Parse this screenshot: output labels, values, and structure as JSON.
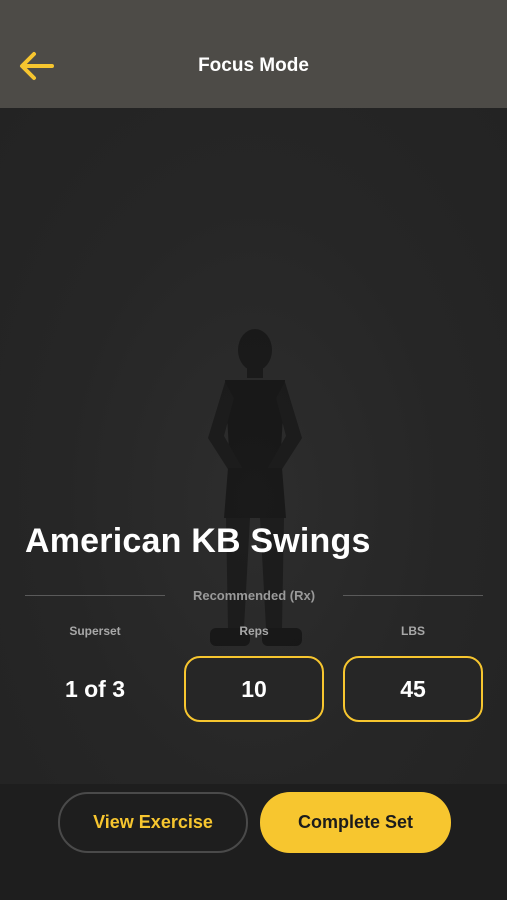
{
  "header": {
    "title": "Focus Mode",
    "back_icon": "arrow-left-icon"
  },
  "exercise": {
    "name": "American KB Swings"
  },
  "recommended": {
    "label": "Recommended (Rx)",
    "columns": {
      "superset": {
        "label": "Superset",
        "value": "1 of 3"
      },
      "reps": {
        "label": "Reps",
        "value": "10"
      },
      "lbs": {
        "label": "LBS",
        "value": "45"
      }
    }
  },
  "footer": {
    "view_exercise": "View Exercise",
    "complete_set": "Complete Set"
  },
  "colors": {
    "accent": "#f7c62f",
    "header_bg": "#4d4b47",
    "background": "#252525",
    "footer_bg": "#1e1e1e"
  }
}
